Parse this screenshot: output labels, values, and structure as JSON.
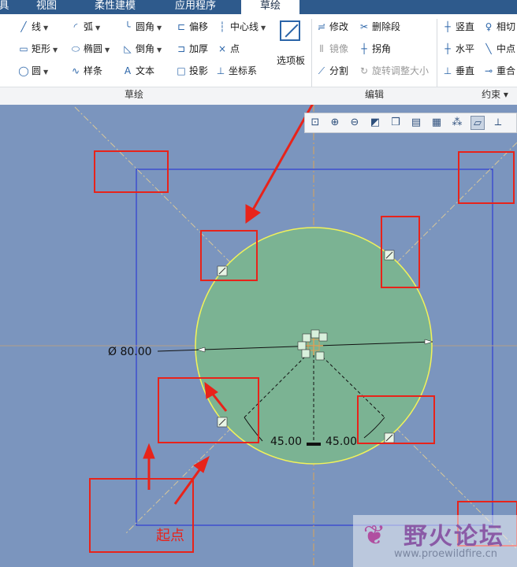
{
  "tabs": [
    {
      "label": "具"
    },
    {
      "label": "视图"
    },
    {
      "label": "柔性建模"
    },
    {
      "label": "应用程序"
    },
    {
      "label": "草绘",
      "active": true
    }
  ],
  "ribbon": {
    "sketch": {
      "line": "线",
      "arc": "弧",
      "fillet": "圆角",
      "offset": "偏移",
      "centerline": "中心线",
      "rectangle": "矩形",
      "ellipse": "椭圆",
      "chamfer": "倒角",
      "thicken": "加厚",
      "point": "点",
      "circle": "圆",
      "spline": "样条",
      "text": "文本",
      "project": "投影",
      "coordsys": "坐标系",
      "palette": "选项板"
    },
    "edit": {
      "modify": "修改",
      "delete_segment": "删除段",
      "mirror": "镜像",
      "corner": "拐角",
      "divide": "分割",
      "rotate_resize": "旋转调整大小"
    },
    "constrain": {
      "vertical": "竖直",
      "tangent": "相切",
      "horizontal": "水平",
      "midpoint": "中点",
      "perpendicular": "垂直",
      "coincident": "重合"
    },
    "groups": {
      "sketch": "草绘",
      "edit": "编辑",
      "constrain": "约束 ▾"
    }
  },
  "sketch": {
    "diameter_label": "Ø 80.00",
    "angle_left": "45.00",
    "angle_right": "45.00",
    "start_label": "起点"
  },
  "watermark": {
    "name": "野火论坛",
    "url": "www.proewildfire.cn"
  },
  "colors": {
    "canvas": "#7b95be",
    "circle_fill": "#7bb393",
    "circle_stroke": "#f2f25a",
    "annotation": "#e8231a",
    "sketch_box": "#1f2bd6",
    "active_tab": "#ffffff"
  }
}
